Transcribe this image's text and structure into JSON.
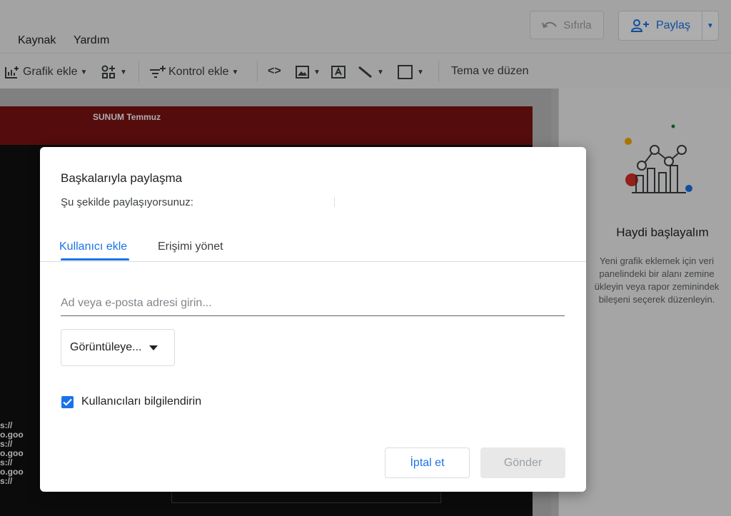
{
  "menu": {
    "items": [
      "Kaynak",
      "Yardım"
    ]
  },
  "header": {
    "reset_label": "Sıfırla",
    "share_label": "Paylaş"
  },
  "toolbar": {
    "add_chart_label": "Grafik ekle",
    "add_control_label": "Kontrol ekle",
    "theme_label": "Tema ve düzen"
  },
  "report": {
    "title": "SUNUM Temmuz",
    "link_fragments": [
      "s://",
      "o.goo",
      "s://",
      "o.goo",
      "s://",
      "o.goo",
      "s://"
    ]
  },
  "side_panel": {
    "title": "Haydi başlayalım",
    "text_lines": [
      "Yeni grafik eklemek için veri",
      "panelindeki bir alanı zemine",
      "ükleyin veya rapor zeminindek",
      "bileşeni seçerek düzenleyin."
    ]
  },
  "dialog": {
    "title": "Başkalarıyla paylaşma",
    "subtitle": "Şu şekilde paylaşıyorsunuz:",
    "tabs": [
      {
        "label": "Kullanıcı ekle",
        "active": true
      },
      {
        "label": "Erişimi yönet",
        "active": false
      }
    ],
    "email_placeholder": "Ad veya e-posta adresi girin...",
    "role_value": "Görüntüleye...",
    "notify_label": "Kullanıcıları bilgilendirin",
    "notify_checked": true,
    "cancel_label": "İptal et",
    "send_label": "Gönder",
    "send_enabled": false
  },
  "colors": {
    "accent": "#1a73e8",
    "report_header": "#7d1212",
    "scrim": "rgba(0,0,0,0.32)"
  }
}
